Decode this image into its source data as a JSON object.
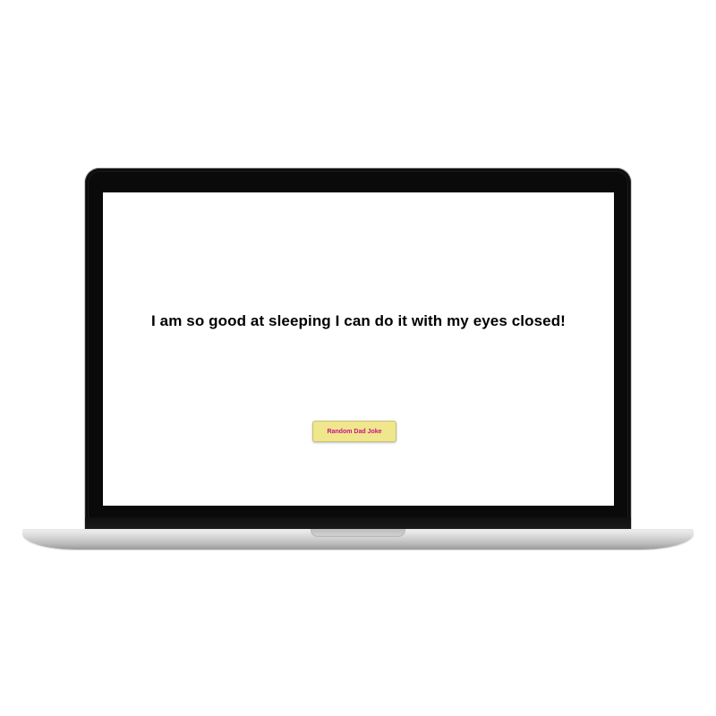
{
  "app": {
    "joke_text": "I am so good at sleeping I can do it with my eyes closed!",
    "button_label": "Random Dad Joke"
  },
  "colors": {
    "button_background": "#f0e68c",
    "button_text": "#c71585",
    "screen_background": "#ffffff",
    "bezel": "#0a0a0a"
  }
}
